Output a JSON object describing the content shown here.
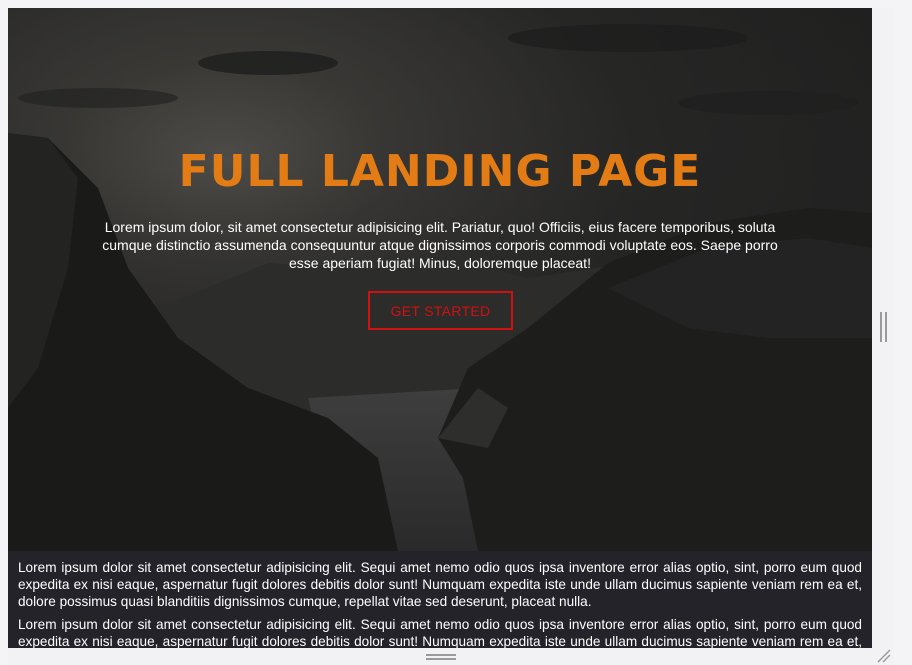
{
  "hero": {
    "title": "FULL LANDING PAGE",
    "text": "Lorem ipsum dolor, sit amet consectetur adipisicing elit. Pariatur, quo! Officiis, eius facere temporibus, soluta cumque distinctio assumenda consequuntur atque dignissimos corporis commodi voluptate eos. Saepe porro esse aperiam fugiat! Minus, doloremque placeat!",
    "cta_label": "GET STARTED",
    "title_color": "#e47c16",
    "cta_color": "#d31010"
  },
  "content": {
    "paragraphs": [
      "Lorem ipsum dolor sit amet consectetur adipisicing elit. Sequi amet nemo odio quos ipsa inventore error alias optio, sint, porro eum quod expedita ex nisi eaque, aspernatur fugit dolores debitis dolor sunt! Numquam expedita iste unde ullam ducimus sapiente veniam rem ea et, dolore possimus quasi blanditiis dignissimos cumque, repellat vitae sed deserunt, placeat nulla.",
      "Lorem ipsum dolor sit amet consectetur adipisicing elit. Sequi amet nemo odio quos ipsa inventore error alias optio, sint, porro eum quod expedita ex nisi eaque, aspernatur fugit dolores debitis dolor sunt! Numquam expedita iste unde ullam ducimus sapiente veniam rem ea et, dolore possimus quasi blanditiis dignissimos cumque, repellat vitae sed deserunt, placeat nulla."
    ]
  },
  "icons": {
    "vertical_resize": "vertical-resize-handle-icon",
    "horizontal_resize": "horizontal-resize-handle-icon",
    "corner_resize": "resize-grip-icon"
  }
}
